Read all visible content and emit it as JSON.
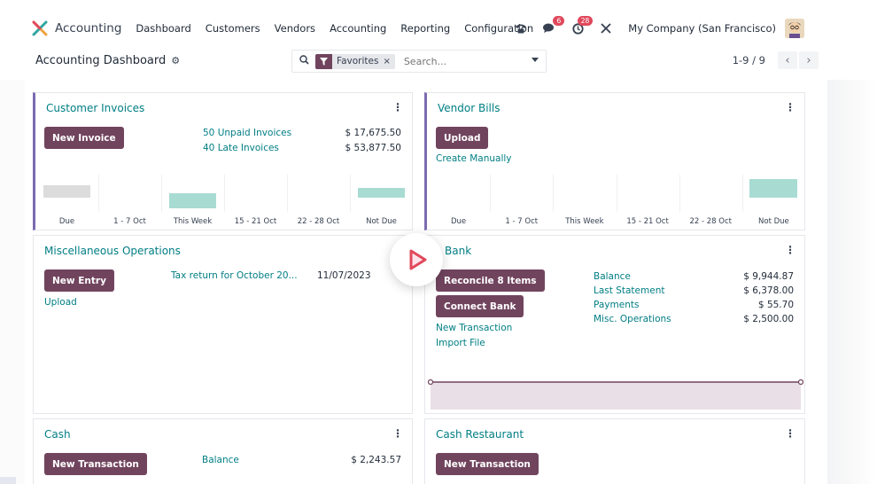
{
  "app": {
    "name": "Accounting",
    "menu": [
      "Dashboard",
      "Customers",
      "Vendors",
      "Accounting",
      "Reporting",
      "Configuration"
    ],
    "messages_badge": "6",
    "activity_badge": "28",
    "company": "My Company (San Francisco)"
  },
  "control": {
    "title": "Accounting Dashboard",
    "facet": "Favorites",
    "search_placeholder": "Search...",
    "pager": "1-9 / 9"
  },
  "graph_labels": [
    "Due",
    "1 - 7 Oct",
    "This Week",
    "15 - 21 Oct",
    "22 - 28 Oct",
    "Not Due"
  ],
  "customer_invoices": {
    "title": "Customer Invoices",
    "button": "New Invoice",
    "unpaid_label": "50 Unpaid Invoices",
    "unpaid_amount": "$ 17,675.50",
    "late_label": "40 Late Invoices",
    "late_amount": "$ 53,877.50",
    "graph_levels": [
      0.5,
      0,
      0.6,
      0,
      0,
      0.4
    ]
  },
  "vendor_bills": {
    "title": "Vendor Bills",
    "button": "Upload",
    "link": "Create Manually",
    "graph_levels": [
      0,
      0,
      0,
      0,
      0,
      0.75
    ]
  },
  "misc_operations": {
    "title": "Miscellaneous Operations",
    "button": "New Entry",
    "link": "Upload",
    "entry_label": "Tax return for October 20...",
    "entry_date": "11/07/2023"
  },
  "bank": {
    "title": "Bank",
    "button_reconcile": "Reconcile 8 Items",
    "button_connect": "Connect Bank",
    "link_new_transaction": "New Transaction",
    "link_import": "Import File",
    "rows": [
      {
        "label": "Balance",
        "amount": "$ 9,944.87"
      },
      {
        "label": "Last Statement",
        "amount": "$ 6,378.00"
      },
      {
        "label": "Payments",
        "amount": "$ 55.70"
      },
      {
        "label": "Misc. Operations",
        "amount": "$ 2,500.00"
      }
    ]
  },
  "cash": {
    "title": "Cash",
    "button": "New Transaction",
    "balance_label": "Balance",
    "balance_amount": "$ 2,243.57"
  },
  "cash_restaurant": {
    "title": "Cash Restaurant",
    "button": "New Transaction"
  },
  "colors": {
    "primary": "#71445e",
    "link": "#017e84",
    "graph_bar": "#a8dcd3",
    "graph_past": "#dcdcdc",
    "bank_area": "#e9dfe6",
    "accent_border": "#7c6bb0"
  }
}
